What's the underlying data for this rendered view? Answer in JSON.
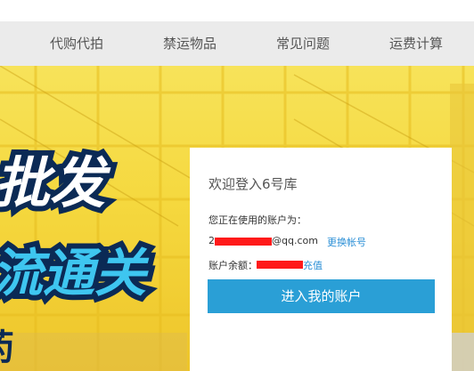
{
  "nav": {
    "items": [
      {
        "label": "代购代拍"
      },
      {
        "label": "禁运物品"
      },
      {
        "label": "常见问题"
      },
      {
        "label": "运费计算"
      }
    ]
  },
  "banner": {
    "headline_1": "批发",
    "headline_2": "流通关",
    "headline_3": "药"
  },
  "login_card": {
    "welcome": "欢迎登入6号库",
    "account_label": "您正在使用的账户为：",
    "account_prefix": "2",
    "account_suffix": "@qq.com",
    "change_account": "更换帐号",
    "balance_label": "账户余额：",
    "recharge": "充值",
    "enter_button": "进入我的账户"
  },
  "colors": {
    "banner_yellow": "#f5d83e",
    "headline_navy": "#0b2a55",
    "headline_cyan": "#3ec6f0",
    "button_blue": "#2a9fd6",
    "link_blue": "#2b8fd6",
    "redaction_red": "#ff1a1a"
  }
}
